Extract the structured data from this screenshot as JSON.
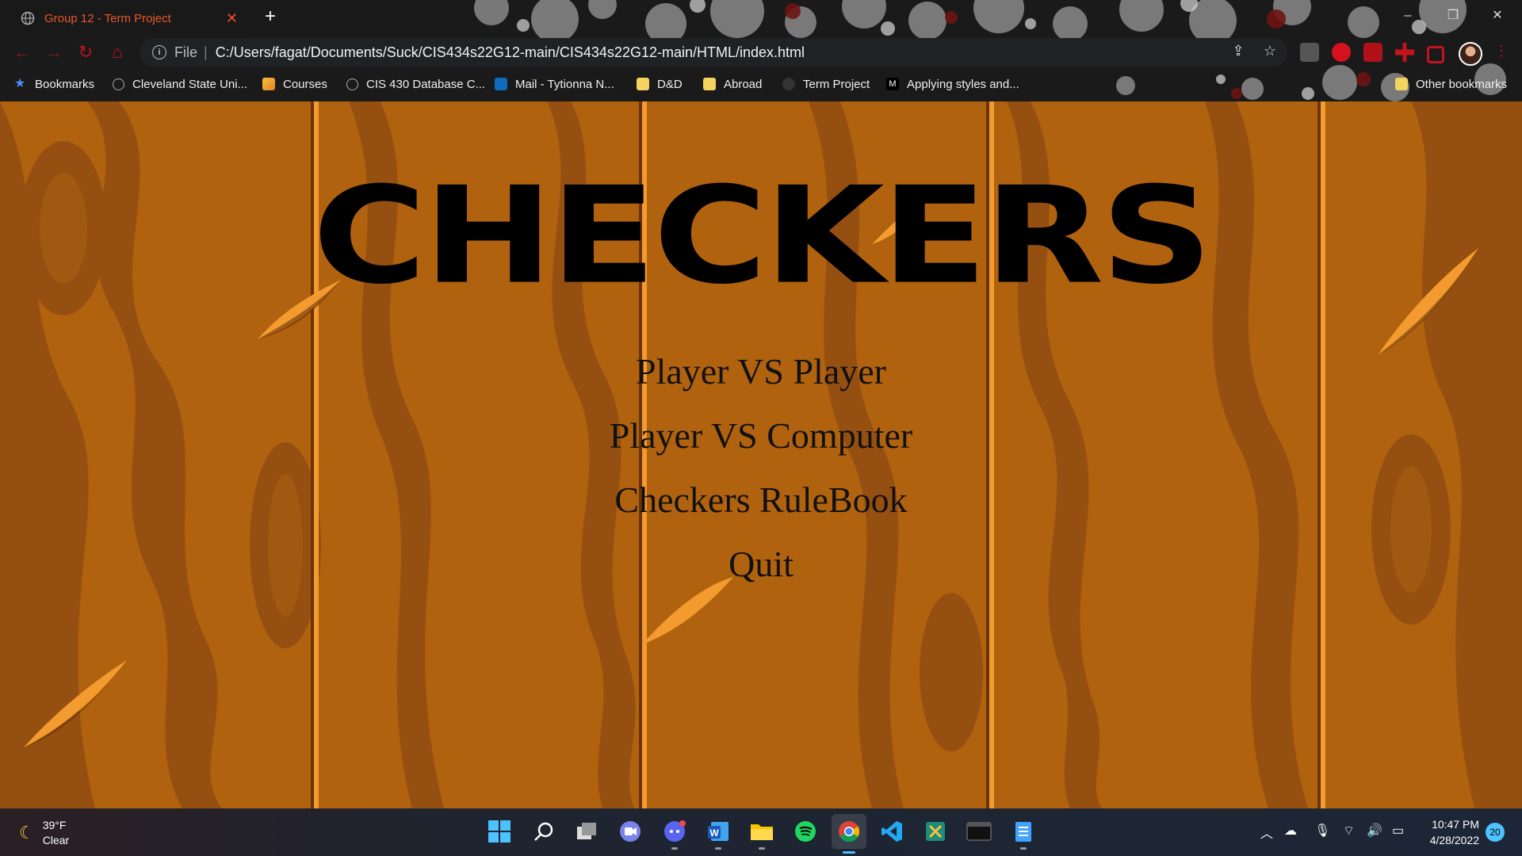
{
  "browser": {
    "tab_title": "Group 12 - Term Project",
    "tab_close": "✕",
    "new_tab": "+",
    "window_controls": [
      "–",
      "❐",
      "✕"
    ],
    "url_scheme_label": "File",
    "url_separator": "|",
    "url": "C:/Users/fagat/Documents/Suck/CIS434s22G12-main/CIS434s22G12-main/HTML/index.html",
    "bookmarks": [
      {
        "label": "Bookmarks",
        "icon": "star-icon"
      },
      {
        "label": "Cleveland State Uni...",
        "icon": "globe-icon"
      },
      {
        "label": "Courses",
        "icon": "pencil-icon"
      },
      {
        "label": "CIS 430 Database C...",
        "icon": "globe-icon"
      },
      {
        "label": "Mail - Tytionna N...",
        "icon": "outlook-icon"
      },
      {
        "label": "D&D",
        "icon": "folder-icon"
      },
      {
        "label": "Abroad",
        "icon": "folder-icon"
      },
      {
        "label": "Term Project",
        "icon": "github-icon"
      },
      {
        "label": "Applying styles and...",
        "icon": "mdn-icon"
      }
    ],
    "other_bookmarks": "Other bookmarks"
  },
  "page": {
    "title": "CHECKERS",
    "menu": [
      "Player VS Player",
      "Player VS Computer",
      "Checkers RuleBook",
      "Quit"
    ]
  },
  "taskbar": {
    "weather_temp": "39°F",
    "weather_desc": "Clear",
    "time": "10:47 PM",
    "date": "4/28/2022",
    "notification_count": "20"
  }
}
